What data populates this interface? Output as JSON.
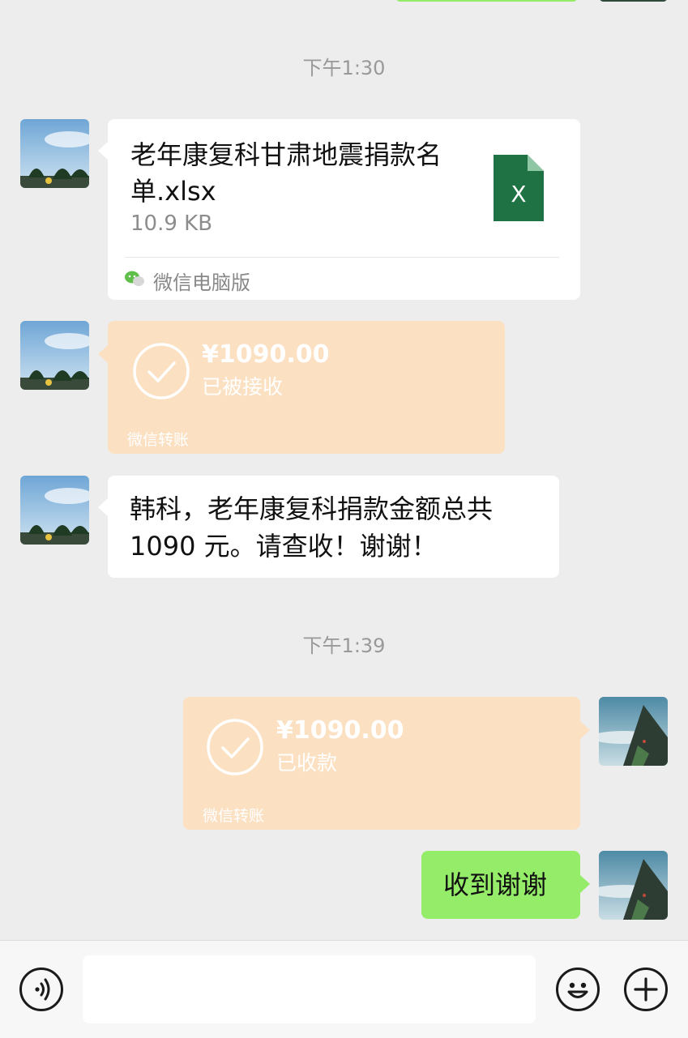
{
  "chat": {
    "time_1": "下午1:30",
    "time_2": "下午1:39",
    "file_message": {
      "name": "老年康复科甘肃地震捐款名单.xlsx",
      "size": "10.9 KB",
      "icon_letter": "X",
      "source": "微信电脑版",
      "file_icon": "excel-file-icon",
      "source_icon": "wechat-logo-icon"
    },
    "transfer_received": {
      "amount": "¥1090.00",
      "status": "已被接收",
      "source": "微信转账"
    },
    "text_message": {
      "line1": "韩科，老年康复科捐款金额总共",
      "line2": "1090 元。请查收！谢谢！"
    },
    "transfer_collected": {
      "amount": "¥1090.00",
      "status": "已收款",
      "source": "微信转账"
    },
    "reply_message": {
      "text": "收到谢谢"
    }
  },
  "input_bar": {
    "voice_icon": "voice-icon",
    "emoji_icon": "emoji-icon",
    "plus_icon": "plus-icon"
  },
  "colors": {
    "background": "#ededed",
    "bubble_white": "#ffffff",
    "bubble_transfer": "#fbe0c2",
    "bubble_sent": "#95ec69",
    "excel_green": "#1f7244"
  }
}
